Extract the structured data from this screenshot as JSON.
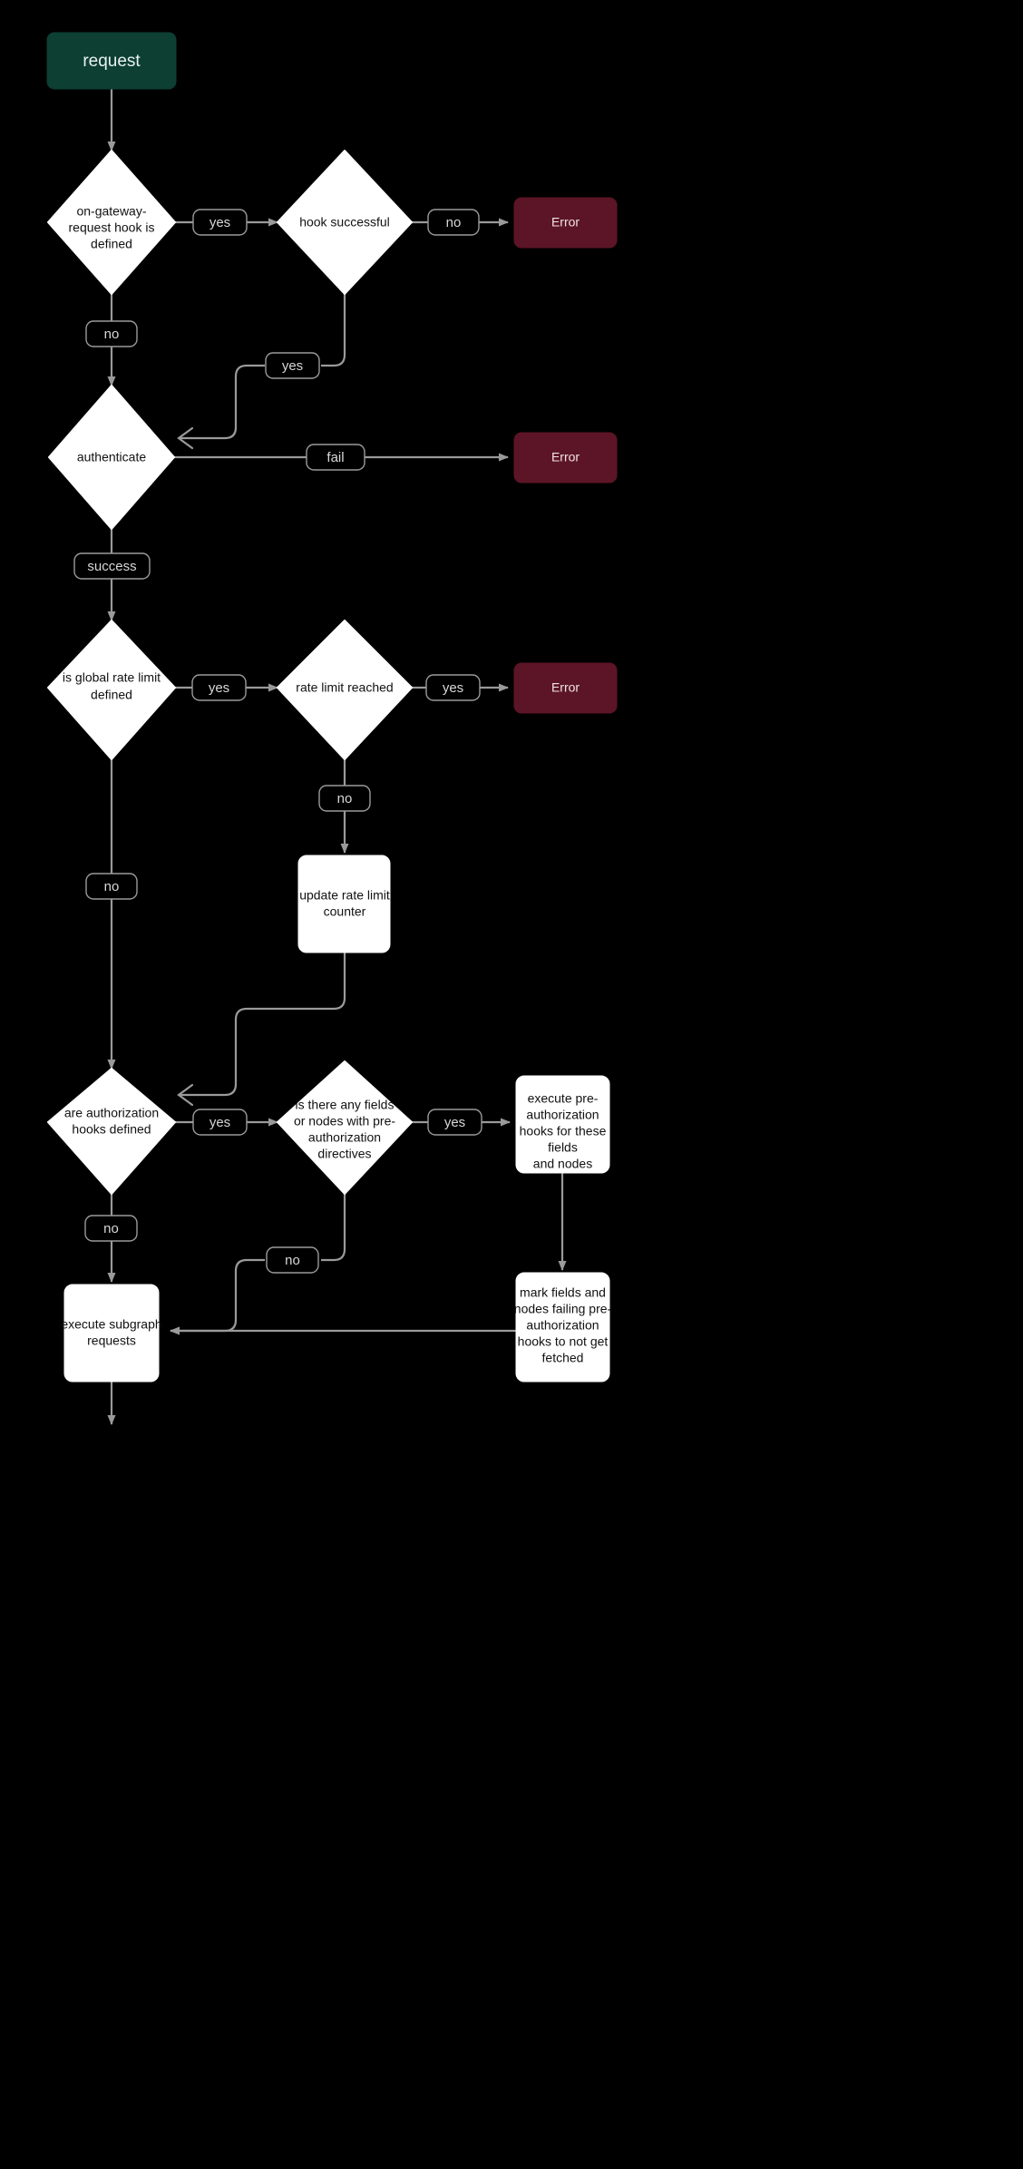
{
  "diagram": {
    "title": "GraphQL gateway request lifecycle flowchart",
    "background_color": "#000000",
    "edge_color": "#9a9a9a",
    "accent_colors": {
      "start": "#0d3f33",
      "error": "#5c1526",
      "node": "#ffffff",
      "node_text": "#111111",
      "label_text": "#d8d8d8"
    },
    "nodes": {
      "start_request": "request",
      "d_on_gateway_hook": "on-gateway-request hook is defined",
      "d_on_gateway_hook_lines": [
        "on-gateway-",
        "request hook is",
        "defined"
      ],
      "d_hook_successful": "hook successful",
      "d_hook_successful_lines": [
        "hook successful"
      ],
      "error_hook": "Error",
      "d_authenticate": "authenticate",
      "d_authenticate_lines": [
        "authenticate"
      ],
      "error_auth": "Error",
      "d_global_rate_limit": "is global rate limit defined",
      "d_global_rate_limit_lines": [
        "is global rate limit",
        "defined"
      ],
      "d_rate_limit_reached": "rate limit reached",
      "d_rate_limit_reached_lines": [
        "rate limit reached"
      ],
      "error_rate_limit": "Error",
      "p_update_counter": "update rate limit counter",
      "p_update_counter_lines": [
        "update rate limit",
        "counter"
      ],
      "d_authz_hooks": "are authorization hooks defined",
      "d_authz_hooks_lines": [
        "are authorization",
        "hooks defined"
      ],
      "d_preauth_directives": "is there any fields or nodes with pre-authorization directives",
      "d_preauth_directives_lines": [
        "is there any fields",
        "or nodes with pre-",
        "authorization",
        "directives"
      ],
      "p_execute_preauth": "execute pre-authorization hooks for these fields and nodes",
      "p_execute_preauth_lines": [
        "execute pre-",
        "authorization",
        "hooks for these",
        "fields",
        "and nodes"
      ],
      "p_mark_fields": "mark fields and nodes failing pre-authorization hooks to not get fetched",
      "p_mark_fields_lines": [
        "mark fields and",
        "nodes failing pre-",
        "authorization",
        "hooks to not get",
        "fetched"
      ],
      "p_execute_subgraph": "execute subgraph requests",
      "p_execute_subgraph_lines": [
        "execute subgraph",
        "requests"
      ]
    },
    "edge_labels": {
      "hook_defined_yes": "yes",
      "hook_defined_no": "no",
      "hook_success_no": "no",
      "hook_success_yes": "yes",
      "auth_fail": "fail",
      "auth_success": "success",
      "rate_limit_defined_yes": "yes",
      "rate_limit_defined_no": "no",
      "rate_limit_reached_yes": "yes",
      "rate_limit_reached_no": "no",
      "authz_hooks_yes": "yes",
      "authz_hooks_no": "no",
      "preauth_yes": "yes",
      "preauth_no": "no"
    }
  }
}
